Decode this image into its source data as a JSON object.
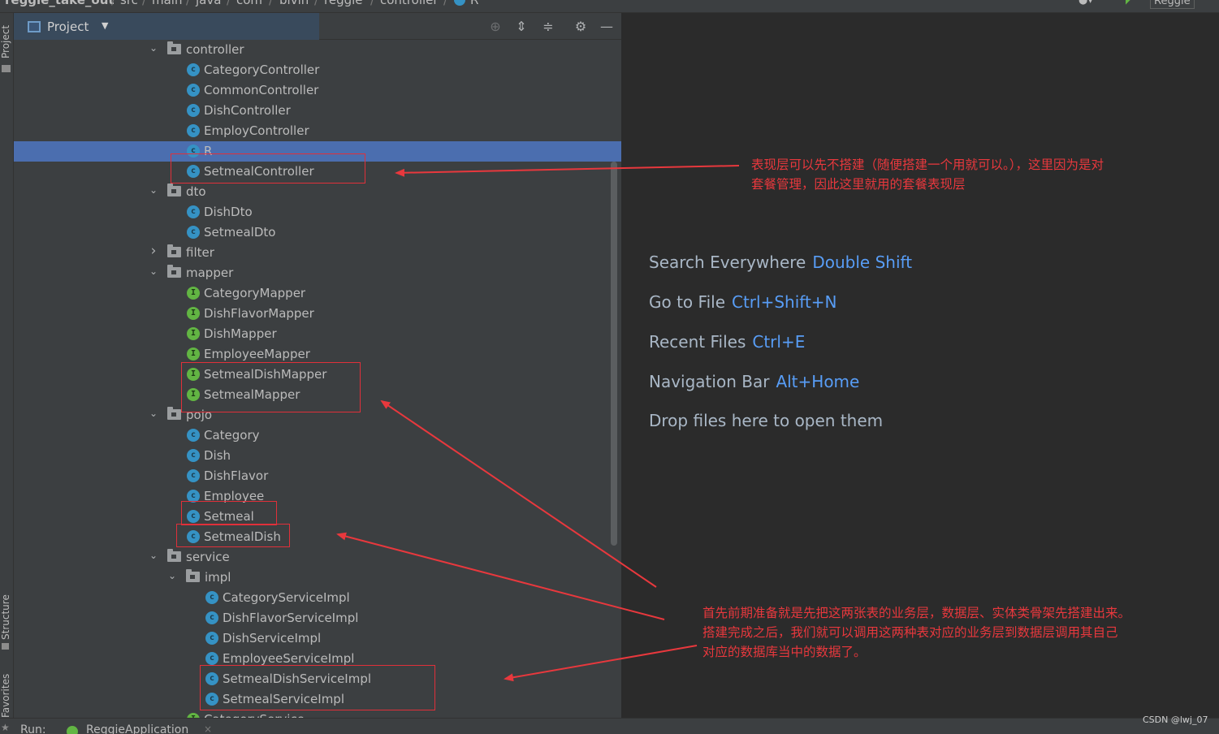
{
  "breadcrumb": {
    "items": [
      "reggie_take_out",
      "src",
      "main",
      "java",
      "com",
      "bivin",
      "reggie",
      "controller",
      "R"
    ],
    "run_config": "Reggie"
  },
  "left_strip": {
    "project_tab": "Project",
    "structure_tab": "Structure",
    "favorites_tab": "Favorites"
  },
  "panel": {
    "title": "Project",
    "tool_icons": [
      "locate-icon",
      "expand-all-icon",
      "collapse-all-icon",
      "gear-icon",
      "minimize-icon"
    ]
  },
  "tree": [
    {
      "label": "controller",
      "kind": "folder",
      "expanded": true
    },
    {
      "label": "CategoryController",
      "kind": "class"
    },
    {
      "label": "CommonController",
      "kind": "class"
    },
    {
      "label": "DishController",
      "kind": "class"
    },
    {
      "label": "EmployController",
      "kind": "class"
    },
    {
      "label": "R",
      "kind": "class",
      "selected": true
    },
    {
      "label": "SetmealController",
      "kind": "class"
    },
    {
      "label": "dto",
      "kind": "folder",
      "expanded": true
    },
    {
      "label": "DishDto",
      "kind": "class"
    },
    {
      "label": "SetmealDto",
      "kind": "class"
    },
    {
      "label": "filter",
      "kind": "folder",
      "expanded": false
    },
    {
      "label": "mapper",
      "kind": "folder",
      "expanded": true
    },
    {
      "label": "CategoryMapper",
      "kind": "interface"
    },
    {
      "label": "DishFlavorMapper",
      "kind": "interface"
    },
    {
      "label": "DishMapper",
      "kind": "interface"
    },
    {
      "label": "EmployeeMapper",
      "kind": "interface"
    },
    {
      "label": "SetmealDishMapper",
      "kind": "interface"
    },
    {
      "label": "SetmealMapper",
      "kind": "interface"
    },
    {
      "label": "pojo",
      "kind": "folder",
      "expanded": true
    },
    {
      "label": "Category",
      "kind": "class"
    },
    {
      "label": "Dish",
      "kind": "class"
    },
    {
      "label": "DishFlavor",
      "kind": "class"
    },
    {
      "label": "Employee",
      "kind": "class"
    },
    {
      "label": "Setmeal",
      "kind": "class"
    },
    {
      "label": "SetmealDish",
      "kind": "class"
    },
    {
      "label": "service",
      "kind": "folder",
      "expanded": true
    },
    {
      "label": "impl",
      "kind": "folder",
      "expanded": true
    },
    {
      "label": "CategoryServiceImpl",
      "kind": "class"
    },
    {
      "label": "DishFlavorServiceImpl",
      "kind": "class"
    },
    {
      "label": "DishServiceImpl",
      "kind": "class"
    },
    {
      "label": "EmployeeServiceImpl",
      "kind": "class"
    },
    {
      "label": "SetmealDishServiceImpl",
      "kind": "class"
    },
    {
      "label": "SetmealServiceImpl",
      "kind": "class"
    },
    {
      "label": "CategoryService",
      "kind": "interface"
    }
  ],
  "editor": {
    "hints": [
      {
        "text": "Search Everywhere",
        "shortcut": "Double Shift"
      },
      {
        "text": "Go to File",
        "shortcut": "Ctrl+Shift+N"
      },
      {
        "text": "Recent Files",
        "shortcut": "Ctrl+E"
      },
      {
        "text": "Navigation Bar",
        "shortcut": "Alt+Home"
      },
      {
        "text": "Drop files here to open them",
        "shortcut": ""
      }
    ]
  },
  "annotations": {
    "top": [
      "表现层可以先不搭建（随便搭建一个用就可以。），这里因为是对",
      "套餐管理，因此这里就用的套餐表现层"
    ],
    "bottom": [
      "首先前期准备就是先把这两张表的业务层，数据层、实体类骨架先搭建出来。",
      "搭建完成之后，我们就可以调用这两种表对应的业务层到数据层调用其自己",
      "对应的数据库当中的数据了。"
    ],
    "color": "#e8383d"
  },
  "run_bar": {
    "label": "Run:",
    "app": "ReggieApplication",
    "close": "×"
  },
  "watermark": "CSDN @lwj_07",
  "colors": {
    "selection": "#4b6eaf",
    "class_icon": "#3592c4",
    "interface_icon": "#62b543",
    "shortcut": "#589df6"
  }
}
